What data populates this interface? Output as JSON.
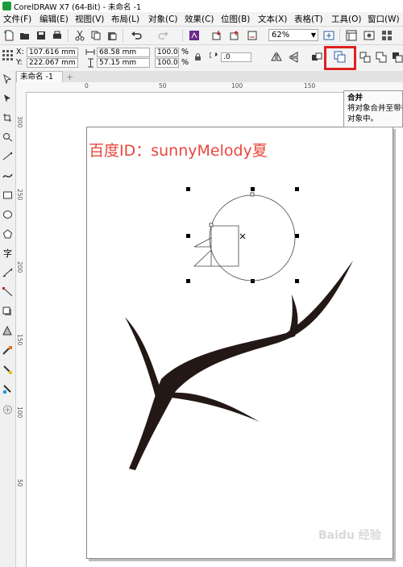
{
  "app": {
    "title": "CorelDRAW X7 (64-Bit) - 未命名 -1",
    "brand_color": "#1f9a3a"
  },
  "menu": [
    {
      "label": "文件(F)"
    },
    {
      "label": "编辑(E)"
    },
    {
      "label": "视图(V)"
    },
    {
      "label": "布局(L)"
    },
    {
      "label": "对象(C)"
    },
    {
      "label": "效果(C)"
    },
    {
      "label": "位图(B)"
    },
    {
      "label": "文本(X)"
    },
    {
      "label": "表格(T)"
    },
    {
      "label": "工具(O)"
    },
    {
      "label": "窗口(W)"
    }
  ],
  "toolbar": {
    "zoom_value": "62%"
  },
  "properties": {
    "x_label": "X:",
    "x_value": "107.616 mm",
    "y_label": "Y:",
    "y_value": "222.067 mm",
    "width_value": "68.58 mm",
    "height_value": "57.15 mm",
    "scale_x": "100.0",
    "scale_y": "100.0",
    "percent": "%",
    "rotation_value": ".0"
  },
  "document": {
    "tab_label": "未命名 -1",
    "add_tab": "+"
  },
  "ruler": {
    "h_ticks": [
      "0",
      "50",
      "100",
      "150"
    ],
    "v_ticks": [
      "300",
      "250",
      "200",
      "150",
      "100",
      "50"
    ]
  },
  "tooltip": {
    "title": "合并",
    "line1": "将对象合并至带有",
    "line2": "对象中。"
  },
  "page": {
    "watermark_text": "百度ID：sunnyMelody夏",
    "watermark_color": "#e8473d",
    "shape_fill": "#231815"
  },
  "footer": {
    "baidu_text": "Baidu 经验"
  },
  "highlight_color": "#e02020"
}
